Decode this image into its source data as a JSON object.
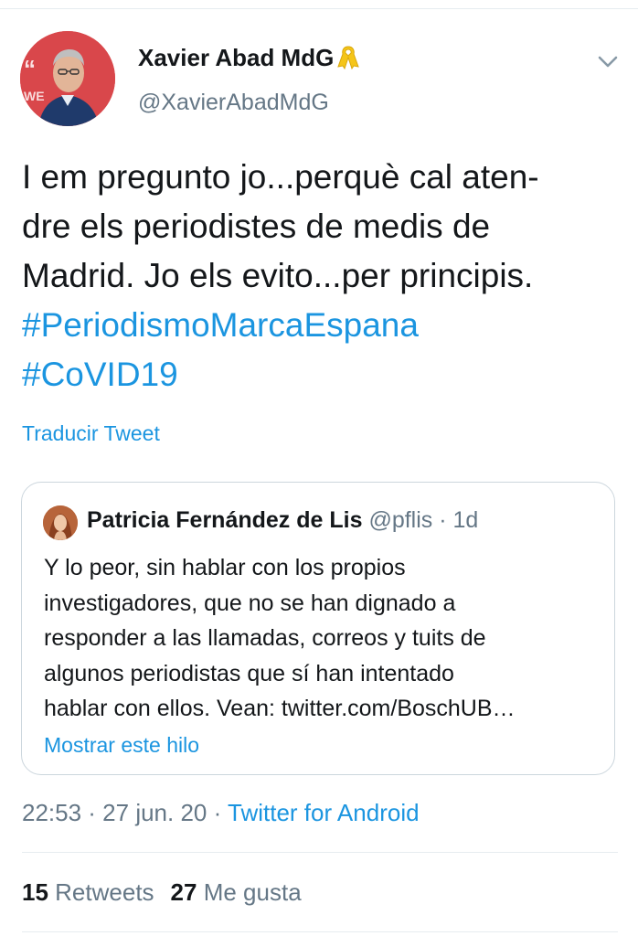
{
  "tweet": {
    "author": {
      "name": "Xavier Abad MdG",
      "handle": "@XavierAbadMdG",
      "badge_icon": "yellow-ribbon-icon",
      "avatar_icon": "profile-photo"
    },
    "menu_icon": "chevron-down-icon",
    "text_lines": [
      "I em pregunto jo...perquè cal aten-",
      "dre els periodistes de medis de",
      "Madrid. Jo els evito...per principis."
    ],
    "hashtags": [
      "#PeriodismoMarcaEspana",
      "#CoVID19"
    ],
    "translate_label": "Traducir Tweet",
    "timestamp": "22:53 · 27 jun. 20 · ",
    "source": "Twitter for Android",
    "stats": {
      "retweets_count": "15",
      "retweets_label": "Retweets",
      "likes_count": "27",
      "likes_label": "Me gusta"
    }
  },
  "quoted_tweet": {
    "author_name": "Patricia Fernández de Lis",
    "meta": " @pflis · 1d",
    "avatar_icon": "profile-photo",
    "text_lines": [
      "Y lo peor, sin hablar con los propios",
      "investigadores, que no se han dignado a",
      "responder a las llamadas, correos y tuits de",
      "algunos periodistas que sí han intentado",
      "hablar con ellos. Vean: twitter.com/BoschUB…"
    ],
    "show_thread_label": "Mostrar este hilo"
  },
  "colors": {
    "link": "#1b95e0",
    "text": "#14171a",
    "muted": "#657786",
    "divider": "#e6ecf0"
  }
}
